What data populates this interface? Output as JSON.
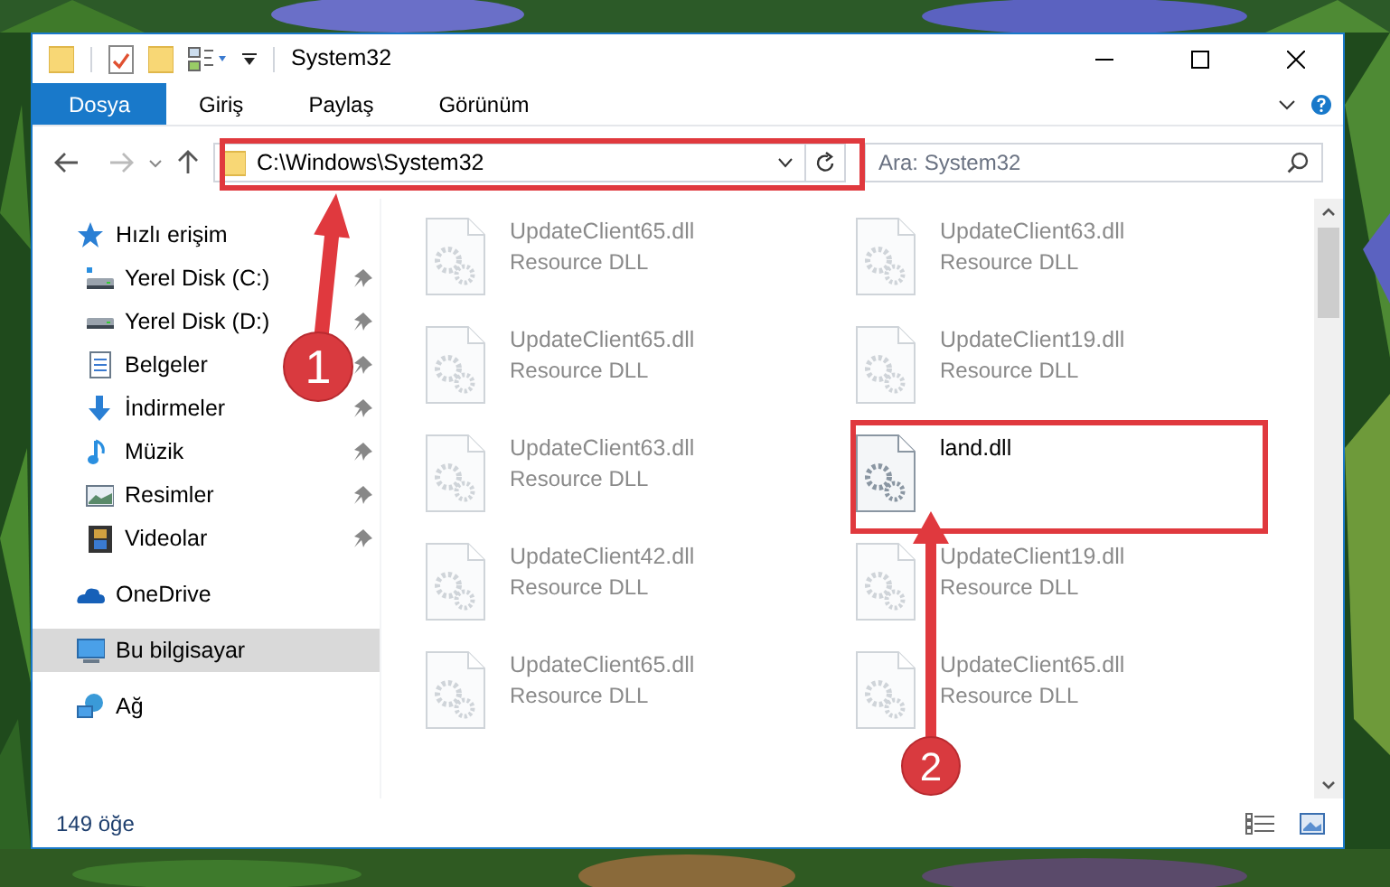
{
  "window": {
    "title": "System32"
  },
  "ribbon_tabs": [
    {
      "label": "Dosya",
      "selected": true
    },
    {
      "label": "Giriş",
      "selected": false
    },
    {
      "label": "Paylaş",
      "selected": false
    },
    {
      "label": "Görünüm",
      "selected": false
    }
  ],
  "address_bar": {
    "path": "C:\\Windows\\System32"
  },
  "search": {
    "placeholder": "Ara: System32"
  },
  "sidebar": {
    "items": [
      {
        "label": "Hızlı erişim",
        "kind": "star",
        "selected": false,
        "children": [
          {
            "label": "Yerel Disk (C:)",
            "kind": "windrive",
            "pinned": true
          },
          {
            "label": "Yerel Disk (D:)",
            "kind": "drive",
            "pinned": true
          },
          {
            "label": "Belgeler",
            "kind": "documents",
            "pinned": true
          },
          {
            "label": "İndirmeler",
            "kind": "downloads",
            "pinned": true
          },
          {
            "label": "Müzik",
            "kind": "music",
            "pinned": true
          },
          {
            "label": "Resimler",
            "kind": "pictures",
            "pinned": true
          },
          {
            "label": "Videolar",
            "kind": "videos",
            "pinned": true
          }
        ]
      },
      {
        "label": "OneDrive",
        "kind": "cloud",
        "selected": false
      },
      {
        "label": "Bu bilgisayar",
        "kind": "computer",
        "selected": true
      },
      {
        "label": "Ağ",
        "kind": "network",
        "selected": false
      }
    ]
  },
  "files": [
    {
      "name": "UpdateClient65.dll",
      "type": "Resource DLL",
      "blurred": true
    },
    {
      "name": "UpdateClient63.dll",
      "type": "Resource DLL",
      "blurred": true
    },
    {
      "name": "UpdateClient65.dll",
      "type": "Resource DLL",
      "blurred": true
    },
    {
      "name": "UpdateClient19.dll",
      "type": "Resource DLL",
      "blurred": true
    },
    {
      "name": "UpdateClient63.dll",
      "type": "Resource DLL",
      "blurred": true
    },
    {
      "name": "land.dll",
      "blurred": false
    },
    {
      "name": "UpdateClient42.dll",
      "type": "Resource DLL",
      "blurred": true
    },
    {
      "name": "UpdateClient19.dll",
      "type": "Resource DLL",
      "blurred": true
    },
    {
      "name": "UpdateClient65.dll",
      "type": "Resource DLL",
      "blurred": true
    },
    {
      "name": "UpdateClient65.dll",
      "type": "Resource DLL",
      "blurred": true
    }
  ],
  "status_bar": {
    "item_count": "149 öğe"
  },
  "annotations": [
    {
      "number": "1"
    },
    {
      "number": "2"
    }
  ]
}
